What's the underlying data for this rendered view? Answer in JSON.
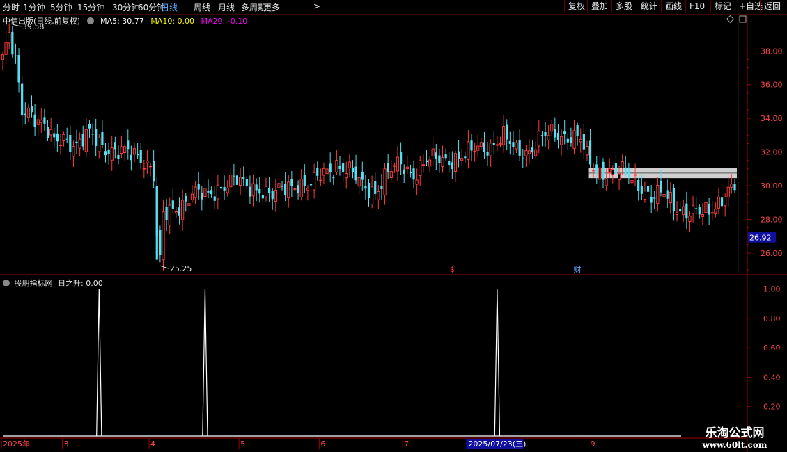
{
  "toolbar": {
    "periods": [
      "分时",
      "1分钟",
      "5分钟",
      "15分钟",
      "30分钟",
      "60分钟",
      "日线",
      "周线",
      "月线",
      "多周期",
      "更多"
    ],
    "active_period": "日线",
    "more_arrow": ">",
    "buttons": [
      "复权",
      "叠加",
      "多股",
      "统计",
      "画线",
      "F10",
      "标记",
      "+自选",
      "返回"
    ]
  },
  "main_legend": {
    "title": "中信出版(日线,前复权)",
    "ma5": "MA5: 30.77",
    "ma10": "MA10: 0.00",
    "ma20": "MA20: -0.10",
    "colors": {
      "ma5": "#ffffff",
      "ma10": "#ffff00",
      "ma20": "#ff00ff"
    }
  },
  "sub_legend": {
    "title": "股朋指标网",
    "indicator": "日之升: 0.00"
  },
  "price_axis": {
    "ticks": [
      "38.00",
      "36.00",
      "34.00",
      "32.00",
      "30.00",
      "28.00",
      "26.00"
    ],
    "min": 24.8,
    "max": 40.2,
    "current_price": "26.92",
    "high_label": "39.58",
    "low_label": "25.25"
  },
  "indicator_axis": {
    "ticks": [
      "1.00",
      "0.80",
      "0.60",
      "0.40",
      "0.20"
    ],
    "min": 0,
    "max": 1.05
  },
  "time_axis": {
    "labels": [
      {
        "text": "2025年",
        "i": 0
      },
      {
        "text": "3",
        "i": 19
      },
      {
        "text": "4",
        "i": 46
      },
      {
        "text": "5",
        "i": 74
      },
      {
        "text": "6",
        "i": 99
      },
      {
        "text": "7",
        "i": 125
      },
      {
        "text": "8",
        "i": 152
      },
      {
        "text": "9",
        "i": 183
      }
    ],
    "cursor": {
      "text": "2025/07/23(三)",
      "i": 145
    }
  },
  "event_markers": [
    {
      "text": "$",
      "i": 140,
      "color": "#ff3333"
    },
    {
      "text": "财",
      "i": 179,
      "color": "#5aa9ff"
    }
  ],
  "signal_days": [
    30,
    63,
    154
  ],
  "colors": {
    "up": "#ff3b3b",
    "down": "#54e0f0",
    "axis": "#a00000",
    "grid": "#3a0000",
    "box": "#cfcfcf"
  },
  "watermark": {
    "line1": "乐淘公式网",
    "line2": "www.60lt.com"
  },
  "chart_data": {
    "type": "candlestick",
    "close_anchors": [
      [
        0,
        37.6
      ],
      [
        2,
        38.8
      ],
      [
        4,
        37.2
      ],
      [
        6,
        34.4
      ],
      [
        8,
        34.6
      ],
      [
        12,
        33.7
      ],
      [
        16,
        32.5
      ],
      [
        19,
        32.9
      ],
      [
        23,
        32.4
      ],
      [
        27,
        33.0
      ],
      [
        31,
        32.4
      ],
      [
        36,
        32.0
      ],
      [
        43,
        31.7
      ],
      [
        46,
        31.2
      ],
      [
        47,
        30.7
      ],
      [
        48,
        26.9
      ],
      [
        49,
        25.5
      ],
      [
        50,
        28.1
      ],
      [
        54,
        28.6
      ],
      [
        59,
        29.6
      ],
      [
        64,
        29.3
      ],
      [
        68,
        30.0
      ],
      [
        72,
        30.4
      ],
      [
        76,
        29.8
      ],
      [
        80,
        29.9
      ],
      [
        84,
        29.4
      ],
      [
        88,
        29.8
      ],
      [
        92,
        30.2
      ],
      [
        96,
        30.0
      ],
      [
        100,
        30.7
      ],
      [
        104,
        31.3
      ],
      [
        108,
        30.8
      ],
      [
        112,
        30.0
      ],
      [
        116,
        29.7
      ],
      [
        120,
        30.7
      ],
      [
        124,
        31.3
      ],
      [
        128,
        30.7
      ],
      [
        132,
        31.4
      ],
      [
        136,
        31.6
      ],
      [
        140,
        31.6
      ],
      [
        144,
        31.7
      ],
      [
        148,
        32.3
      ],
      [
        152,
        32.4
      ],
      [
        156,
        32.8
      ],
      [
        160,
        32.1
      ],
      [
        164,
        32.1
      ],
      [
        168,
        32.8
      ],
      [
        172,
        33.1
      ],
      [
        176,
        33.0
      ],
      [
        180,
        32.7
      ],
      [
        182,
        31.6
      ],
      [
        185,
        30.9
      ],
      [
        190,
        30.8
      ],
      [
        195,
        30.6
      ],
      [
        198,
        30.2
      ],
      [
        202,
        29.2
      ],
      [
        206,
        29.5
      ],
      [
        210,
        28.8
      ],
      [
        214,
        28.3
      ],
      [
        218,
        28.3
      ],
      [
        222,
        28.9
      ],
      [
        225,
        29.5
      ],
      [
        228,
        29.8
      ]
    ],
    "count": 229,
    "ylim": [
      24.8,
      40.2
    ],
    "highlight_band": [
      30.45,
      31.05
    ]
  }
}
